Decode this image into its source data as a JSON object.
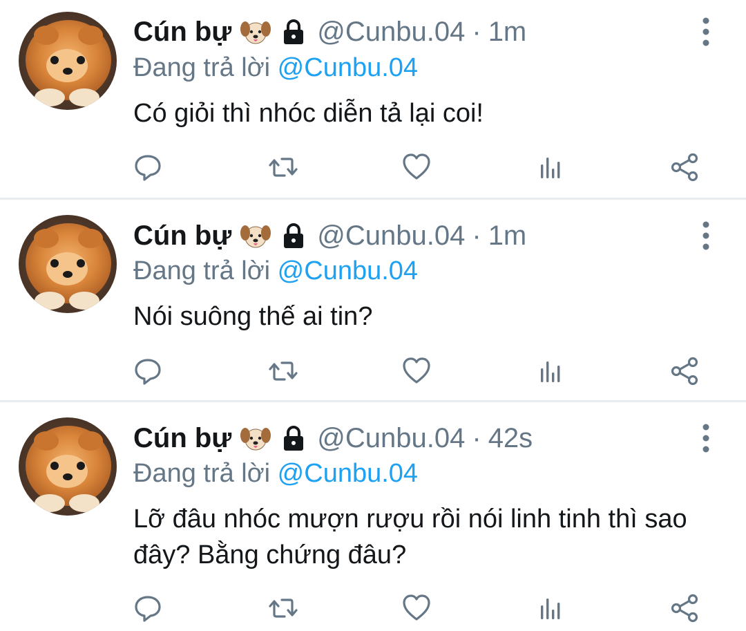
{
  "colors": {
    "text": "#14171a",
    "secondary": "#657786",
    "link": "#1da1f2",
    "divider": "#e6ecf0"
  },
  "tweets": [
    {
      "display_name": "Cún bự",
      "handle": "@Cunbu.04",
      "separator": "·",
      "time": "1m",
      "replying_prefix": "Đang trả lời",
      "replying_to": "@Cunbu.04",
      "text": "Có giỏi thì nhóc diễn tả lại coi!",
      "emoji_icon": "dog-face-icon",
      "protected_icon": "lock-icon"
    },
    {
      "display_name": "Cún bự",
      "handle": "@Cunbu.04",
      "separator": "·",
      "time": "1m",
      "replying_prefix": "Đang trả lời",
      "replying_to": "@Cunbu.04",
      "text": "Nói suông thế ai tin?",
      "emoji_icon": "dog-face-icon",
      "protected_icon": "lock-icon"
    },
    {
      "display_name": "Cún bự",
      "handle": "@Cunbu.04",
      "separator": "·",
      "time": "42s",
      "replying_prefix": "Đang trả lời",
      "replying_to": "@Cunbu.04",
      "text": "Lỡ đâu nhóc mượn rượu rồi nói linh tinh thì sao đây? Bằng chứng đâu?",
      "emoji_icon": "dog-face-icon",
      "protected_icon": "lock-icon"
    }
  ],
  "action_icons": [
    "reply-icon",
    "retweet-icon",
    "like-icon",
    "stats-icon",
    "share-icon"
  ]
}
